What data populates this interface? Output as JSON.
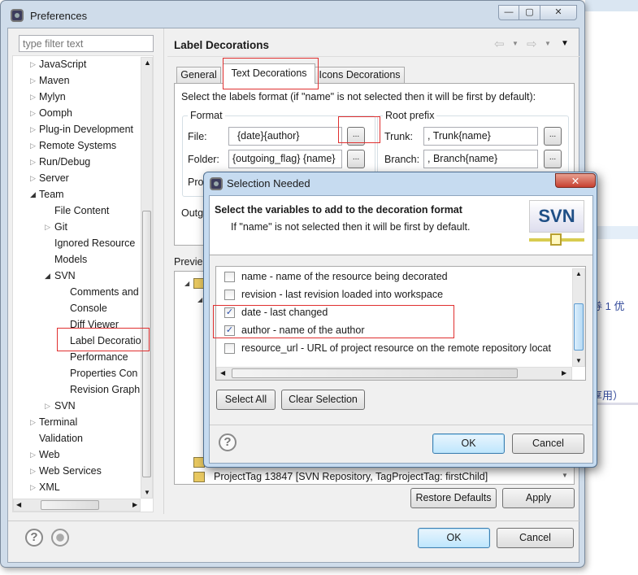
{
  "background": {
    "text1": "券 1 优",
    "text2": "享用）"
  },
  "window": {
    "title": "Preferences",
    "minimize": "—",
    "maximize": "▢",
    "close": "✕"
  },
  "filter": {
    "placeholder": "type filter text"
  },
  "tree": [
    {
      "label": "JavaScript",
      "level": 0,
      "arrow": "collapsed"
    },
    {
      "label": "Maven",
      "level": 0,
      "arrow": "collapsed"
    },
    {
      "label": "Mylyn",
      "level": 0,
      "arrow": "collapsed"
    },
    {
      "label": "Oomph",
      "level": 0,
      "arrow": "collapsed"
    },
    {
      "label": "Plug-in Development",
      "level": 0,
      "arrow": "collapsed"
    },
    {
      "label": "Remote Systems",
      "level": 0,
      "arrow": "collapsed"
    },
    {
      "label": "Run/Debug",
      "level": 0,
      "arrow": "collapsed"
    },
    {
      "label": "Server",
      "level": 0,
      "arrow": "collapsed"
    },
    {
      "label": "Team",
      "level": 0,
      "arrow": "expanded"
    },
    {
      "label": "File Content",
      "level": 1,
      "arrow": "none"
    },
    {
      "label": "Git",
      "level": 1,
      "arrow": "collapsed"
    },
    {
      "label": "Ignored Resource",
      "level": 1,
      "arrow": "none"
    },
    {
      "label": "Models",
      "level": 1,
      "arrow": "none"
    },
    {
      "label": "SVN",
      "level": 1,
      "arrow": "expanded"
    },
    {
      "label": "Comments and",
      "level": 2,
      "arrow": "none"
    },
    {
      "label": "Console",
      "level": 2,
      "arrow": "none"
    },
    {
      "label": "Diff Viewer",
      "level": 2,
      "arrow": "none"
    },
    {
      "label": "Label Decoratio",
      "level": 2,
      "arrow": "none",
      "selected": true
    },
    {
      "label": "Performance",
      "level": 2,
      "arrow": "none"
    },
    {
      "label": "Properties Con",
      "level": 2,
      "arrow": "none"
    },
    {
      "label": "Revision Graph",
      "level": 2,
      "arrow": "none"
    },
    {
      "label": "SVN",
      "level": 1,
      "arrow": "collapsed"
    },
    {
      "label": "Terminal",
      "level": 0,
      "arrow": "collapsed"
    },
    {
      "label": "Validation",
      "level": 0,
      "arrow": "none"
    },
    {
      "label": "Web",
      "level": 0,
      "arrow": "collapsed"
    },
    {
      "label": "Web Services",
      "level": 0,
      "arrow": "collapsed"
    },
    {
      "label": "XML",
      "level": 0,
      "arrow": "collapsed"
    }
  ],
  "page": {
    "title": "Label Decorations",
    "tabs": [
      {
        "label": "General"
      },
      {
        "label": "Text Decorations",
        "selected": true
      },
      {
        "label": "Icons Decorations"
      }
    ],
    "instruction": "Select the labels format (if \"name\" is not selected then it will be first by default):",
    "format": {
      "legend": "Format",
      "file_label": "File:",
      "file_value": "{date}{author}",
      "folder_label": "Folder:",
      "folder_value": "{outgoing_flag} {name}",
      "project_label": "Pro",
      "browse": "..."
    },
    "root": {
      "legend": "Root prefix",
      "trunk_label": "Trunk:",
      "trunk_value": ", Trunk{name}",
      "branch_label": "Branch:",
      "branch_value": ", Branch{name}"
    },
    "outgoing_label": "Outg",
    "preview_label": "Previe",
    "preview_last": "ProjectTag 13847 [SVN Repository, TagProjectTag: firstChild]",
    "restore": "Restore Defaults",
    "apply": "Apply"
  },
  "footer": {
    "ok": "OK",
    "cancel": "Cancel",
    "help": "?"
  },
  "dialog": {
    "title": "Selection Needed",
    "close": "✕",
    "heading": "Select the variables to add to the decoration format",
    "subheading": "If \"name\" is not selected then it will be first by default.",
    "logo": "SVN",
    "items": [
      {
        "label": "name - name of the resource being decorated",
        "checked": false
      },
      {
        "label": "revision - last revision loaded into workspace",
        "checked": false
      },
      {
        "label": "date - last changed",
        "checked": true
      },
      {
        "label": "author - name of the author",
        "checked": true
      },
      {
        "label": "resource_url - URL of project resource on the remote repository locat",
        "checked": false
      }
    ],
    "select_all": "Select All",
    "clear_selection": "Clear Selection",
    "ok": "OK",
    "cancel": "Cancel",
    "help": "?"
  },
  "colors": {
    "highlight": "#e03030",
    "default_button": "#3c7fb1"
  }
}
